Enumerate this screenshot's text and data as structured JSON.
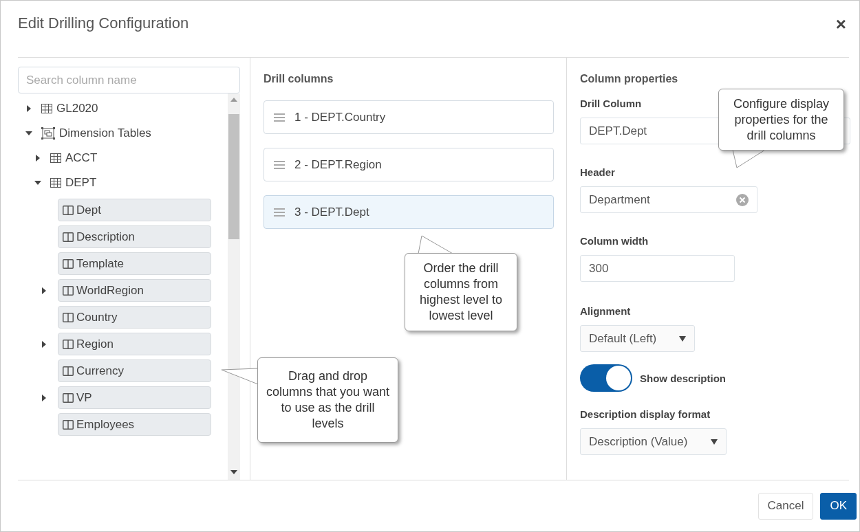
{
  "dialog": {
    "title": "Edit Drilling Configuration",
    "close": "×"
  },
  "tree": {
    "search": {
      "placeholder": "Search column name"
    },
    "items": [
      {
        "label": "GL2020",
        "kind": "table",
        "expanded": false
      },
      {
        "label": "Dimension Tables",
        "kind": "group",
        "expanded": true,
        "children": [
          {
            "label": "ACCT",
            "kind": "table",
            "expanded": false
          },
          {
            "label": "DEPT",
            "kind": "table",
            "expanded": true,
            "children": [
              {
                "label": "Dept",
                "kind": "column"
              },
              {
                "label": "Description",
                "kind": "column"
              },
              {
                "label": "Template",
                "kind": "column"
              },
              {
                "label": "WorldRegion",
                "kind": "hierarchy"
              },
              {
                "label": "Country",
                "kind": "column"
              },
              {
                "label": "Region",
                "kind": "hierarchy"
              },
              {
                "label": "Currency",
                "kind": "column"
              },
              {
                "label": "VP",
                "kind": "hierarchy"
              },
              {
                "label": "Employees",
                "kind": "column"
              }
            ]
          }
        ]
      }
    ]
  },
  "drill_columns": {
    "title": "Drill columns",
    "items": [
      {
        "label": "1 - DEPT.Country",
        "selected": false
      },
      {
        "label": "2 - DEPT.Region",
        "selected": false
      },
      {
        "label": "3 - DEPT.Dept",
        "selected": true
      }
    ]
  },
  "properties": {
    "title": "Column properties",
    "drill_column": {
      "label": "Drill Column",
      "value": "DEPT.Dept"
    },
    "header": {
      "label": "Header",
      "value": "Department"
    },
    "column_width": {
      "label": "Column width",
      "value": "300"
    },
    "alignment": {
      "label": "Alignment",
      "value": "Default (Left)"
    },
    "show_description": {
      "label": "Show description",
      "on": true
    },
    "description_format": {
      "label": "Description display format",
      "value": "Description (Value)"
    }
  },
  "callouts": [
    {
      "text": "Drag and drop columns that you want to use as the drill levels",
      "kind": "left"
    },
    {
      "text": "Order the drill columns from highest level to lowest level",
      "kind": "up"
    },
    {
      "text": "Configure display properties for the drill columns",
      "kind": "down"
    }
  ],
  "buttons": [
    {
      "label": "Cancel",
      "kind": "secondary"
    },
    {
      "label": "OK",
      "kind": "primary"
    }
  ]
}
